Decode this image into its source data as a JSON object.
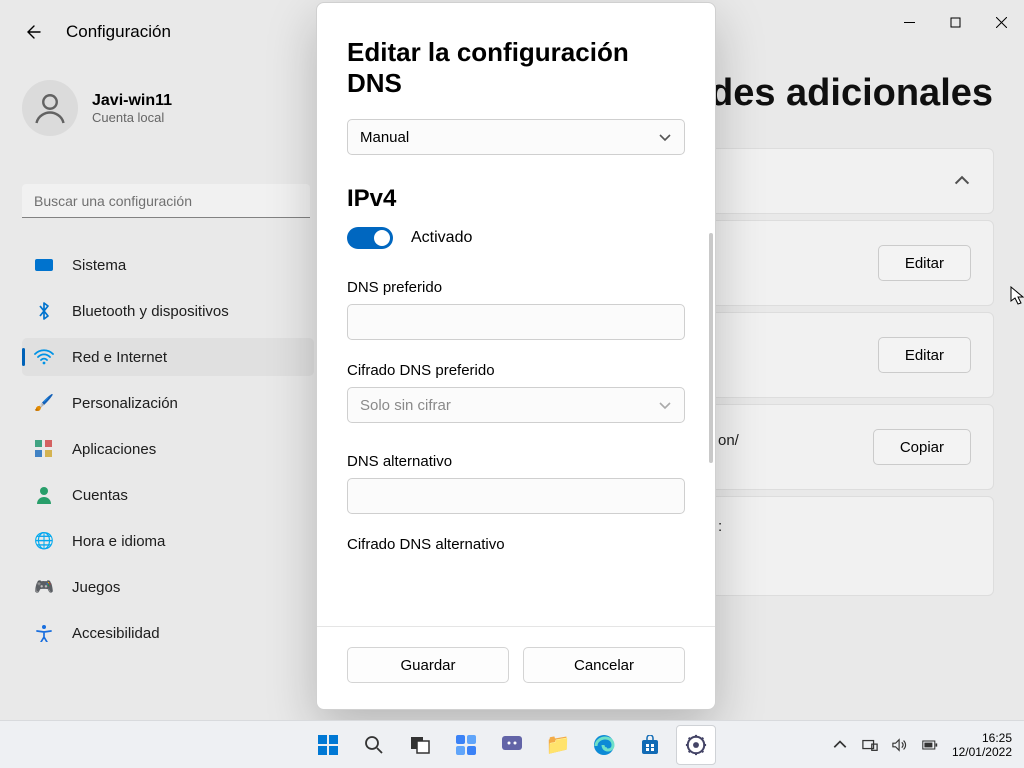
{
  "app_title": "Configuración",
  "user": {
    "name": "Javi-win11",
    "type": "Cuenta local"
  },
  "search": {
    "placeholder": "Buscar una configuración"
  },
  "nav": [
    {
      "label": "Sistema"
    },
    {
      "label": "Bluetooth y dispositivos"
    },
    {
      "label": "Red e Internet"
    },
    {
      "label": "Personalización"
    },
    {
      "label": "Aplicaciones"
    },
    {
      "label": "Cuentas"
    },
    {
      "label": "Hora e idioma"
    },
    {
      "label": "Juegos"
    },
    {
      "label": "Accesibilidad"
    }
  ],
  "page_heading_fragment": "des adicionales",
  "right": {
    "edit": "Editar",
    "copy": "Copiar",
    "frag1": "on/",
    "frag2": ":"
  },
  "dialog": {
    "title": "Editar la configuración DNS",
    "mode": "Manual",
    "section": "IPv4",
    "toggle_label": "Activado",
    "preferred_label": "DNS preferido",
    "pref_enc_label": "Cifrado DNS preferido",
    "pref_enc_value": "Solo sin cifrar",
    "alt_label": "DNS alternativo",
    "alt_enc_label": "Cifrado DNS alternativo",
    "save": "Guardar",
    "cancel": "Cancelar"
  },
  "taskbar": {
    "time": "16:25",
    "date": "12/01/2022"
  }
}
